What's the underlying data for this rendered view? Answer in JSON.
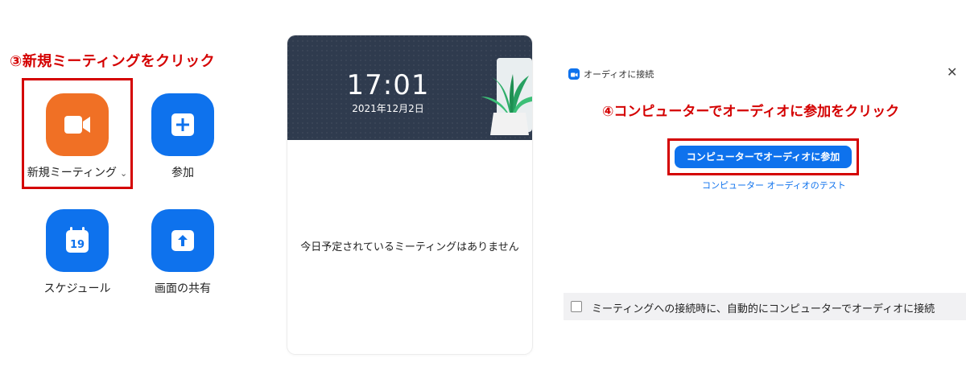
{
  "left": {
    "annotation": "③新規ミーティングをクリック",
    "buttons": {
      "new_meeting": {
        "label": "新規ミーティング",
        "chevron": "⌄",
        "icon": "video-camera-icon",
        "color": "#f07025"
      },
      "join": {
        "label": "参加",
        "icon": "plus-icon",
        "color": "#0e72ed"
      },
      "schedule": {
        "label": "スケジュール",
        "icon": "calendar-icon",
        "day": "19",
        "color": "#0e72ed"
      },
      "share_screen": {
        "label": "画面の共有",
        "icon": "share-up-arrow-icon",
        "color": "#0e72ed"
      }
    },
    "highlight_color": "#d40000"
  },
  "middle": {
    "time": "17:01",
    "date": "2021年12月2日",
    "empty_text": "今日予定されているミーティングはありません",
    "header_color": "#2f3b4e"
  },
  "right": {
    "title": "オーディオに接続",
    "close": "✕",
    "annotation": "④コンピューターでオーディオに参加をクリック",
    "join_button": "コンピューターでオーディオに参加",
    "test_link": "コンピューター オーディオのテスト",
    "auto_join_label": "ミーティングへの接続時に、自動的にコンピューターでオーディオに接続",
    "auto_join_checked": false,
    "accent": "#0e72ed"
  }
}
